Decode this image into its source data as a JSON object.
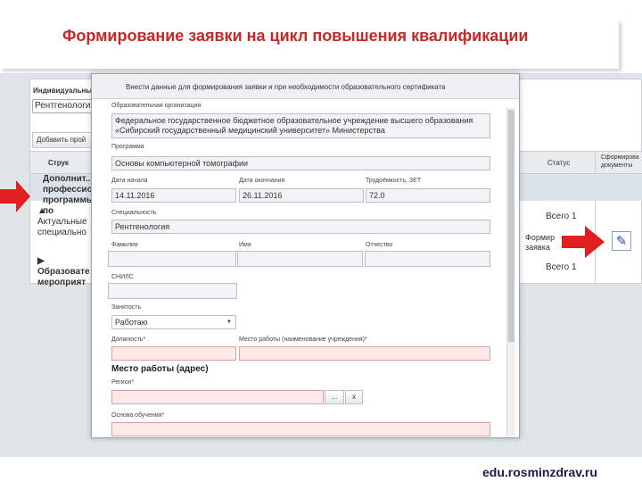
{
  "slide": {
    "title": "Формирование заявки на цикл повышения квалификации",
    "footer_url": "edu.rosminzdrav.ru"
  },
  "background_app": {
    "individual_label": "Индивидуальны",
    "individual_value": "Рентгенология",
    "add_button": "Добавить прой",
    "columns": {
      "structure": "Струк",
      "status": "Статус",
      "documents": "Сформирова\nдокументы"
    },
    "rows": [
      {
        "text": "Дополнит... профессио... программы по",
        "total": ""
      },
      {
        "text": "▲ Актуальные специально",
        "total": "Всего 1"
      },
      {
        "text": "▶ Образовате мероприят",
        "total": "Всего 1"
      }
    ],
    "doc_link": "Формир заявка",
    "pen_icon": "pen-icon"
  },
  "modal": {
    "header": "Внести данные для формирования заявки и при необходимости образовательного сертификата",
    "org_label": "Образовательная организация",
    "org_value": "Федеральное государственное бюджетное образовательное учреждение высшего образования «Сибирский государственный медицинский университет» Министерства",
    "program_label": "Программа",
    "program_value": "Основы компьютерной томографии",
    "start_label": "Дата начала",
    "start_value": "14.11.2016",
    "end_label": "Дата окончания",
    "end_value": "26.11.2016",
    "labor_label": "Трудоёмкость, ЗЕТ",
    "labor_value": "72.0",
    "spec_label": "Специальность",
    "spec_value": "Рентгенология",
    "lastname_label": "Фамилия",
    "firstname_label": "Имя",
    "patronymic_label": "Отчество",
    "snils_label": "СНИЛС",
    "employment_label": "Занятость",
    "employment_value": "Работаю",
    "position_label": "Должность*",
    "workplace_label": "Место работы (наименование учреждения)*",
    "workaddress_heading": "Место работы (адрес)",
    "region_label": "Регион*",
    "region_btn_more": "...",
    "region_btn_clear": "x",
    "basis_label": "Основа обучения*"
  },
  "colors": {
    "title_red": "#c62828",
    "arrow_red": "#e02020",
    "error_field": "#ffe8e8"
  }
}
